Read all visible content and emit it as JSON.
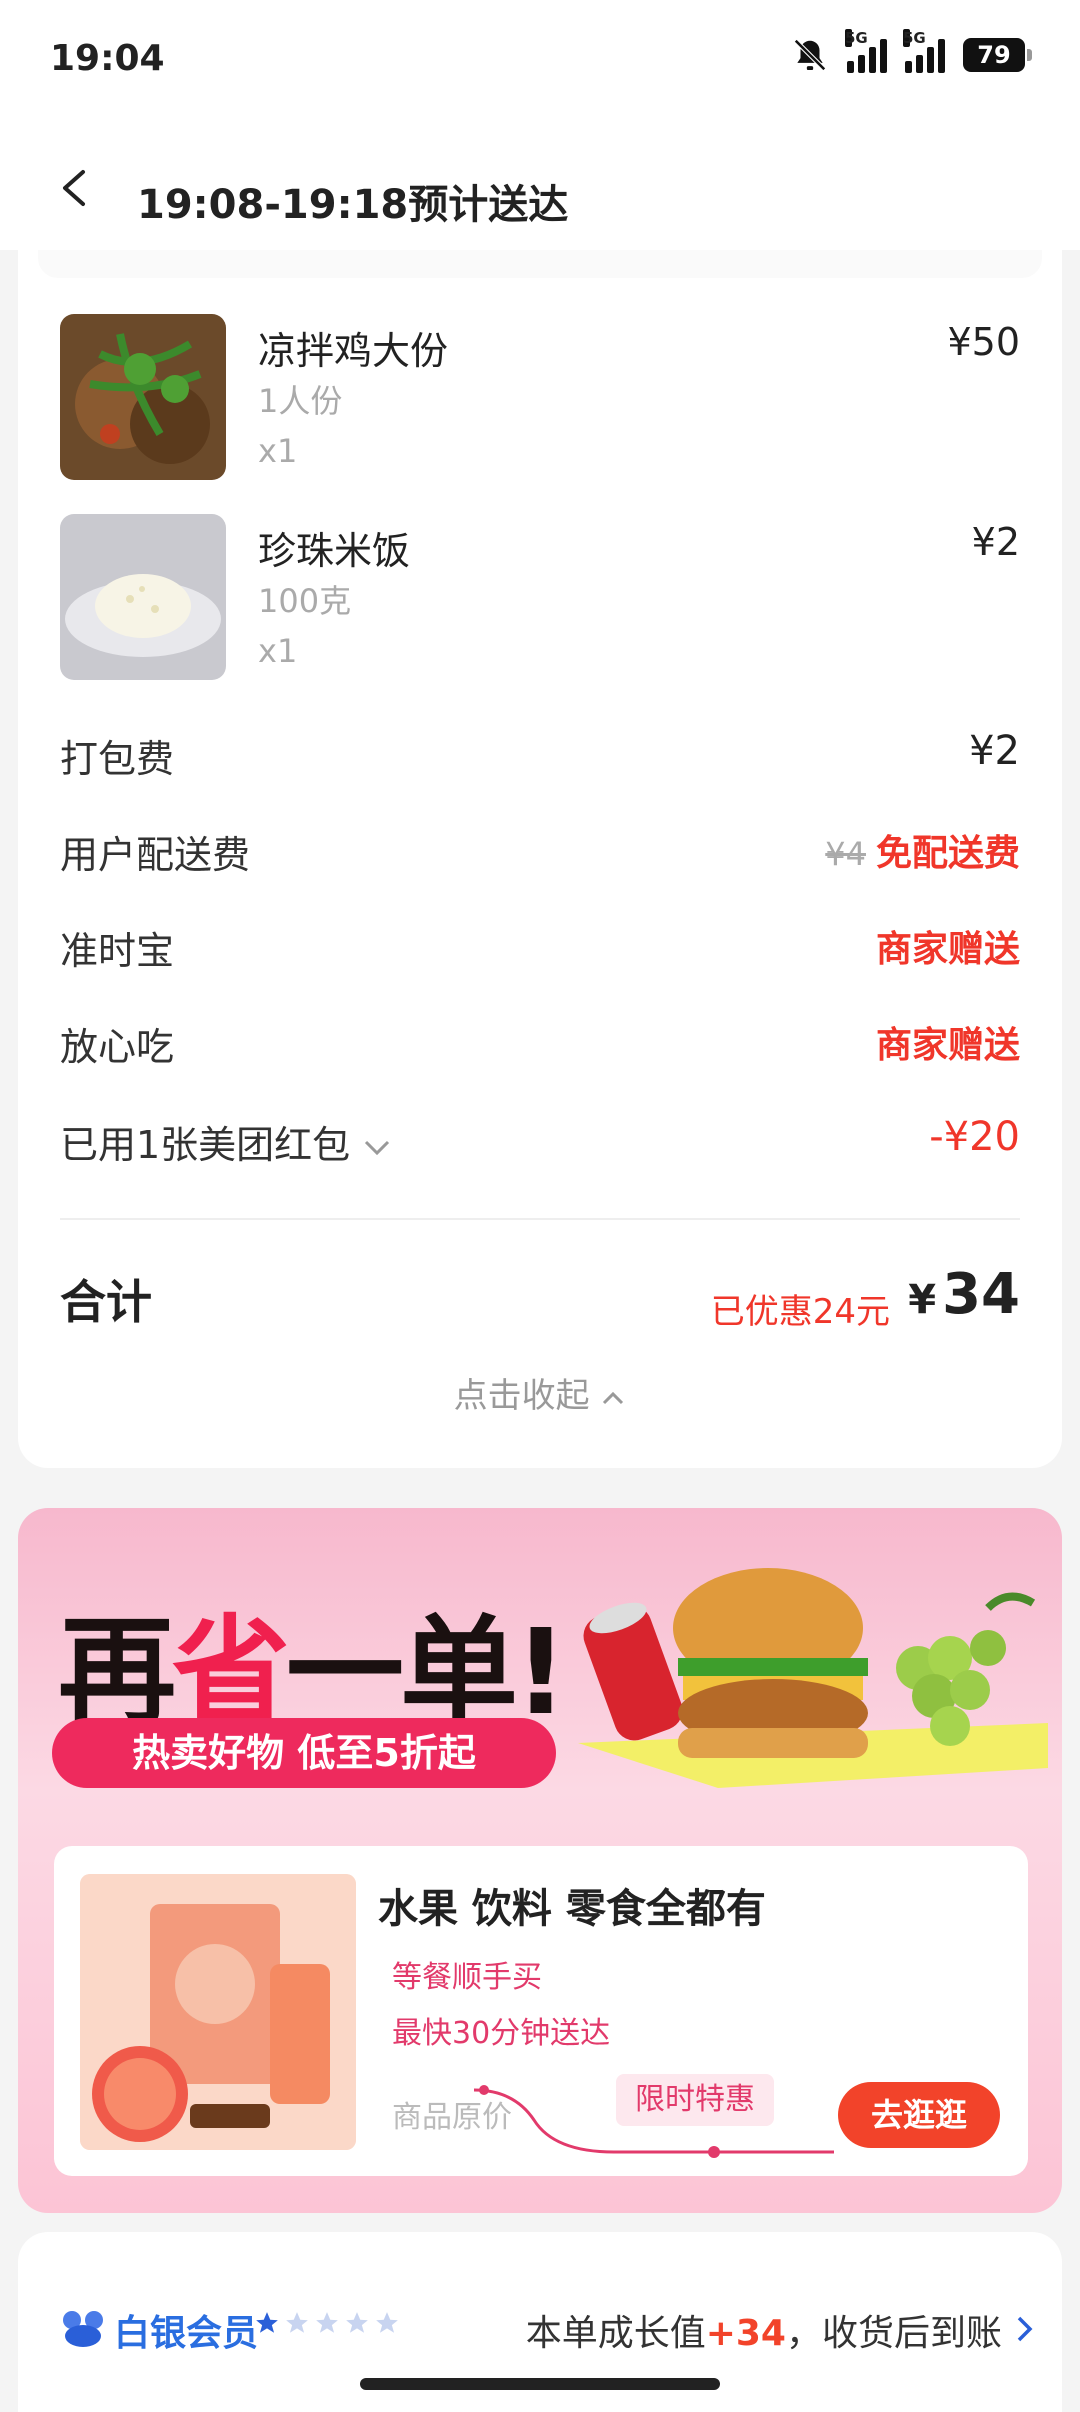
{
  "status_bar": {
    "time": "19:04",
    "net1": "5G",
    "net2": "5G",
    "battery": "79"
  },
  "header": {
    "title": "19:08-19:18预计送达"
  },
  "items": [
    {
      "name": "凉拌鸡大份",
      "spec": "1人份",
      "qty": "x1",
      "price": "¥50"
    },
    {
      "name": "珍珠米饭",
      "spec": "100克",
      "qty": "x1",
      "price": "¥2"
    }
  ],
  "fees": {
    "packing_label": "打包费",
    "packing_value": "¥2",
    "delivery_label": "用户配送费",
    "delivery_orig": "¥4",
    "delivery_value": "免配送费",
    "ontime_label": "准时宝",
    "ontime_value": "商家赠送",
    "safe_label": "放心吃",
    "safe_value": "商家赠送",
    "coupon_label": "已用1张美团红包",
    "coupon_value": "-¥20"
  },
  "total": {
    "label": "合计",
    "saved": "已优惠24元",
    "yen": "¥",
    "amount": "34",
    "collapse": "点击收起"
  },
  "promo": {
    "title_a": "再",
    "title_b": "省",
    "title_c": "一单!",
    "pill": "热卖好物 低至5折起",
    "inner_title": "水果 饮料 零食全都有",
    "sub1": "等餐顺手买",
    "sub2": "最快30分钟送达",
    "orig_price": "商品原价",
    "limited": "限时特惠",
    "button": "去逛逛"
  },
  "member": {
    "level": "白银会员",
    "stars_filled": 1,
    "stars_total": 5,
    "text_before": "本单成长值",
    "points": "+34",
    "text_after": "，收货后到账"
  }
}
